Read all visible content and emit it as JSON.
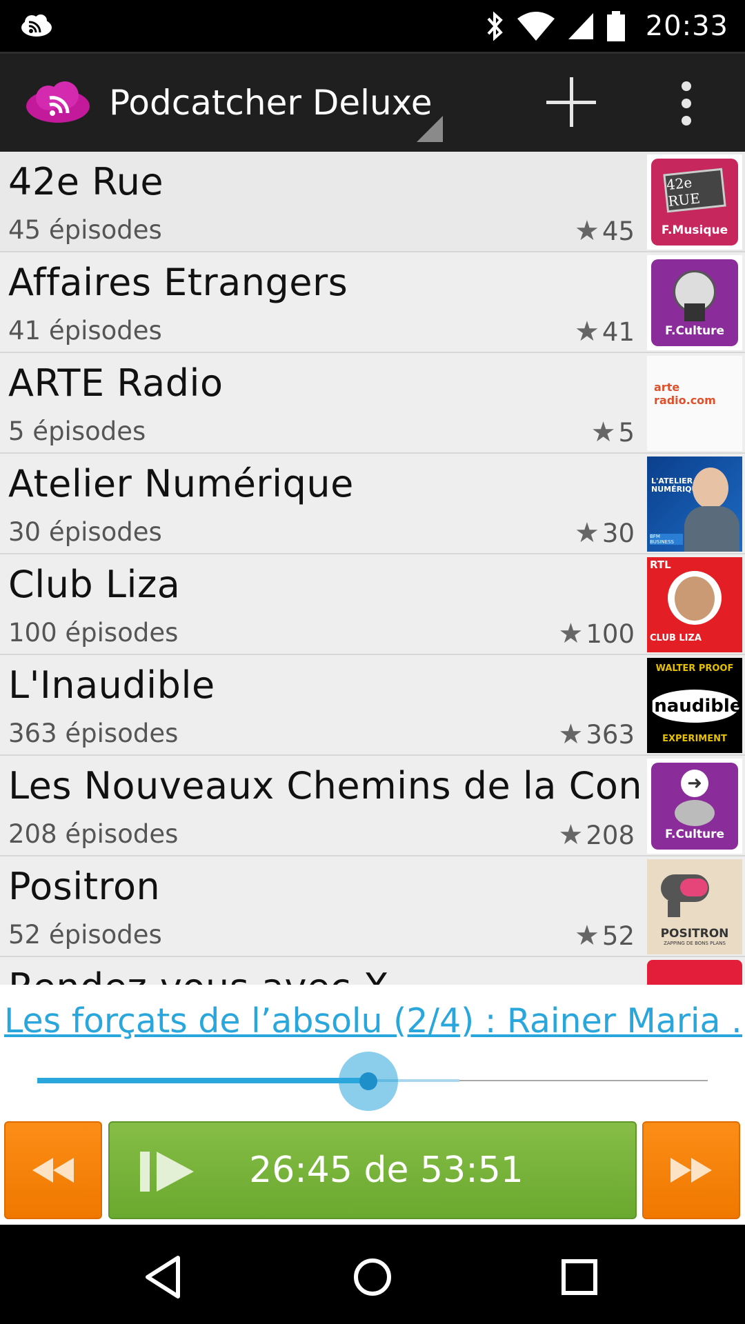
{
  "status_bar": {
    "time": "20:33",
    "icons": [
      "cloud-cast-icon",
      "bluetooth-icon",
      "wifi-icon",
      "signal-icon",
      "battery-icon"
    ]
  },
  "action_bar": {
    "title": "Podcatcher Deluxe",
    "icons": [
      "app-logo",
      "spinner-indicator",
      "add-icon",
      "overflow-menu-icon"
    ]
  },
  "podcasts": [
    {
      "name": "42e Rue",
      "episodes": "45 épisodes",
      "count": "45",
      "thumb_text": "42e RUE",
      "thumb_sub": "F.Musique"
    },
    {
      "name": "Affaires Etrangers",
      "episodes": "41 épisodes",
      "count": "41",
      "thumb_sub": "F.Culture"
    },
    {
      "name": "ARTE Radio",
      "episodes": "5 épisodes",
      "count": "5",
      "thumb_text": "arte radio.com"
    },
    {
      "name": "Atelier Numérique",
      "episodes": "30 épisodes",
      "count": "30",
      "thumb_text": "L'ATELIER NUMÉRIQUE",
      "thumb_sub": "BFM BUSINESS"
    },
    {
      "name": "Club Liza",
      "episodes": "100 épisodes",
      "count": "100",
      "thumb_text": "RTL",
      "thumb_sub": "CLUB LIZA"
    },
    {
      "name": "L'Inaudible",
      "episodes": "363 épisodes",
      "count": "363",
      "thumb_text": "Inaudible",
      "thumb_top": "WALTER PROOF",
      "thumb_sub": "EXPERIMENT"
    },
    {
      "name": "Les Nouveaux Chemins de la Con..",
      "episodes": "208 épisodes",
      "count": "208",
      "thumb_sub": "F.Culture"
    },
    {
      "name": "Positron",
      "episodes": "52 épisodes",
      "count": "52",
      "thumb_text": "POSITRON",
      "thumb_sub": "ZAPPING DE BONS PLANS"
    },
    {
      "name": "Rendez-vous avec X",
      "episodes": "",
      "count": ""
    }
  ],
  "player": {
    "episode_title": "Les forçats de l’absolu (2/4) : Rainer Maria ...",
    "progress_fraction": 0.494,
    "buffer_fraction": 0.63,
    "time_label": "26:45 de 53:51",
    "buttons": [
      "rewind-button",
      "play-pause-button",
      "fast-forward-button"
    ]
  },
  "colors": {
    "accent_blue": "#29a6dc",
    "orange": "#f58300",
    "green": "#76b33c",
    "actionbar_bg": "#1f1f1f",
    "list_bg": "#eeeeee"
  }
}
